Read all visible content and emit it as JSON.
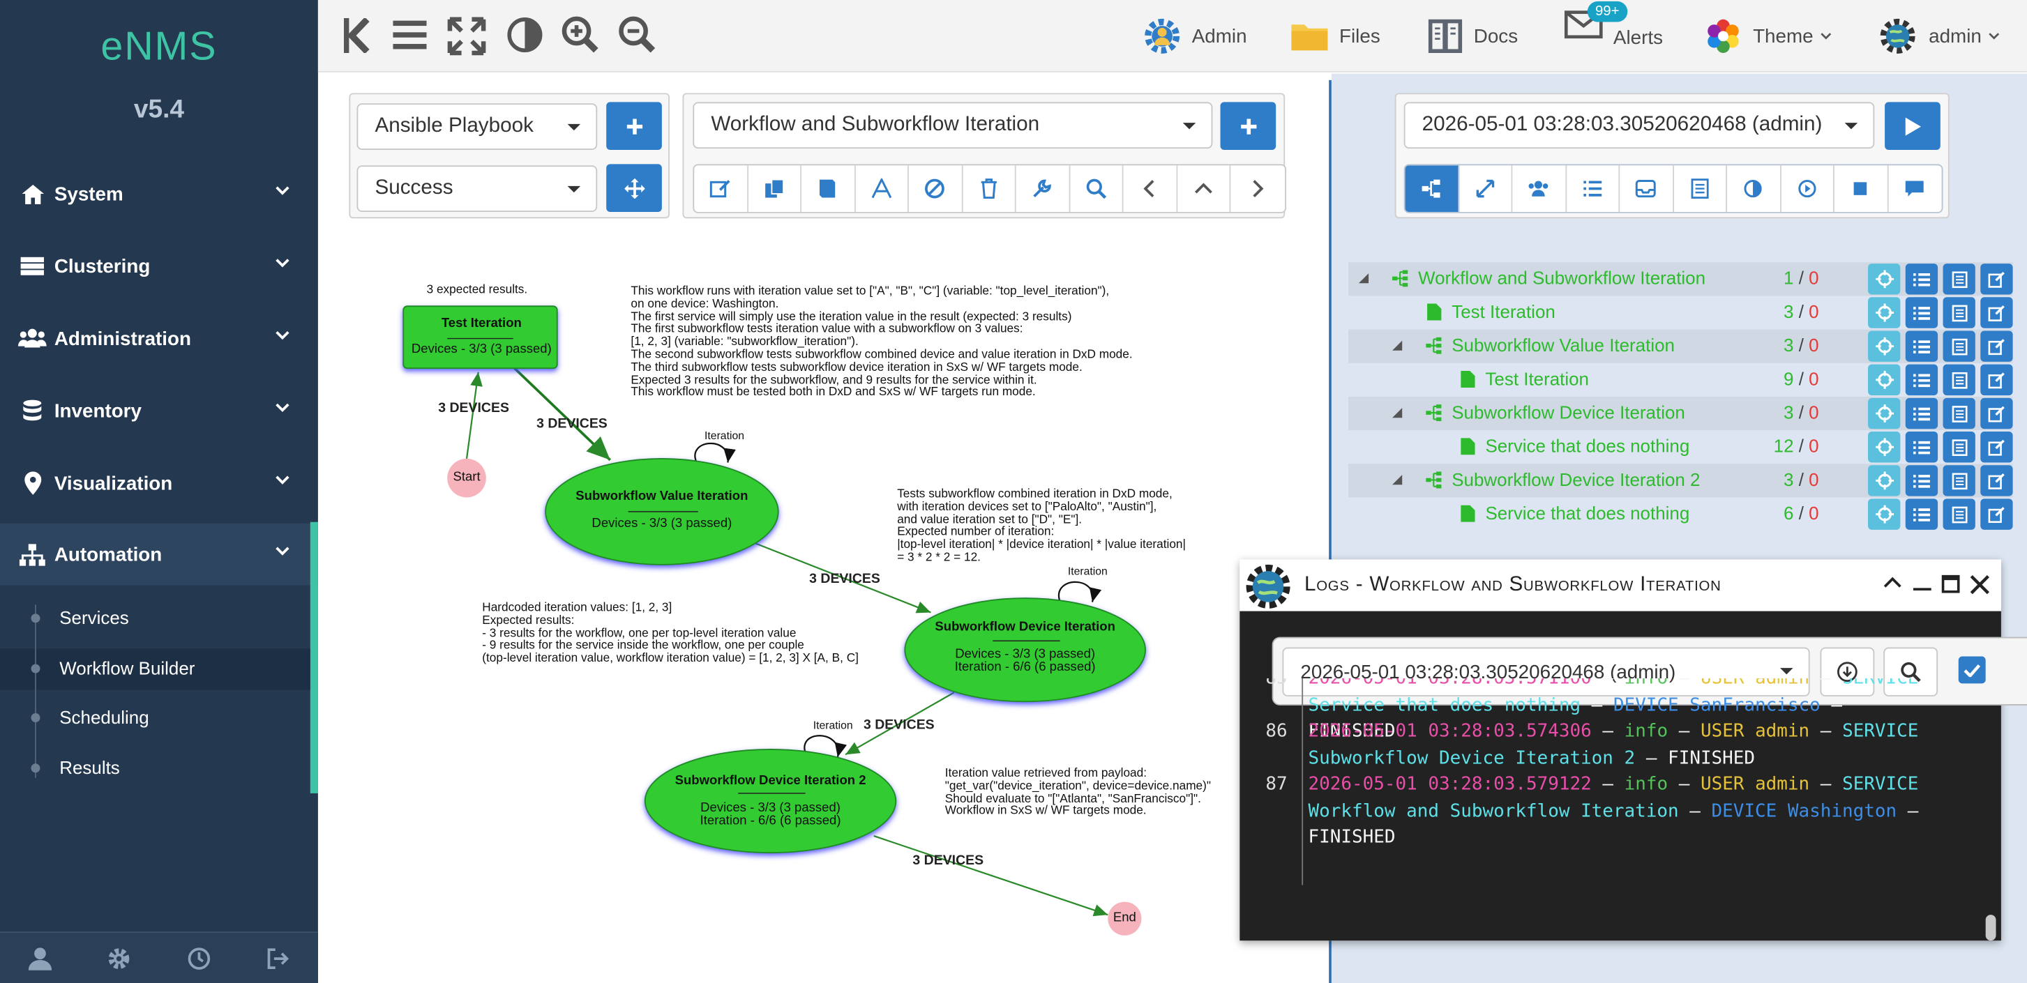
{
  "sidebar": {
    "logo": "eNMS",
    "version": "v5.4",
    "menu": [
      {
        "label": "System",
        "icon": "home-icon"
      },
      {
        "label": "Clustering",
        "icon": "server-icon"
      },
      {
        "label": "Administration",
        "icon": "users-icon"
      },
      {
        "label": "Inventory",
        "icon": "database-icon"
      },
      {
        "label": "Visualization",
        "icon": "map-marker-icon"
      },
      {
        "label": "Automation",
        "icon": "sitemap-icon"
      }
    ],
    "automation_submenu": [
      "Services",
      "Workflow Builder",
      "Scheduling",
      "Results"
    ],
    "active_submenu": "Workflow Builder",
    "footer_icons": [
      "user-icon",
      "gear-icon",
      "history-icon",
      "logout-icon"
    ]
  },
  "topbar": {
    "admin_label": "Admin",
    "files_label": "Files",
    "docs_label": "Docs",
    "alerts_label": "Alerts",
    "alerts_badge": "99+",
    "theme_label": "Theme",
    "user_label": "admin"
  },
  "builder": {
    "service_type": "Ansible Playbook",
    "edge_type": "Success",
    "workflow": "Workflow and Subworkflow Iteration",
    "runtime": "2026-05-01 03:28:03.30520620468 (admin)"
  },
  "diagram": {
    "nodes": {
      "test_iteration": {
        "title": "Test Iteration",
        "line1": "Devices - 3/3 (3 passed)"
      },
      "subwf_value": {
        "title": "Subworkflow Value Iteration",
        "line1": "Devices - 3/3 (3 passed)"
      },
      "subwf_device": {
        "title": "Subworkflow Device Iteration",
        "line1": "Devices - 3/3 (3 passed)",
        "line2": "Iteration - 6/6 (6 passed)"
      },
      "subwf_device2": {
        "title": "Subworkflow Device Iteration 2",
        "line1": "Devices - 3/3 (3 passed)",
        "line2": "Iteration - 6/6 (6 passed)"
      },
      "start": "Start",
      "end": "End"
    },
    "edge_label": "3 DEVICES",
    "loop_label": "Iteration",
    "expected_label": "3 expected results.",
    "note1": "This workflow runs with iteration value set to [\"A\", \"B\", \"C\"] (variable: \"top_level_iteration\"),\non one device: Washington.\nThe first service will simply use the iteration value in the result (expected: 3 results)\nThe first subworkflow tests iteration value with a subworkflow on 3 values:\n[1, 2, 3] (variable: \"subworkflow_iteration\").\nThe second subworkflow tests subworkflow combined device and value iteration in DxD mode.\nThe third subworkflow tests subworkflow device iteration in SxS w/ WF targets mode.\nExpected 3 results for the subworkflow, and 9 results for the service within it.\nThis workflow must be tested both in DxD and SxS w/ WF targets run mode.",
    "note2": "Tests subworkflow combined iteration in DxD mode,\nwith iteration devices set to [\"PaloAlto\", \"Austin\"],\nand value iteration set to [\"D\", \"E\"].\nExpected number of iteration:\n|top-level iteration| * |device iteration| * |value iteration|\n= 3 * 2 * 2 = 12.",
    "note3": "Hardcoded iteration values: [1, 2, 3]\nExpected results:\n- 3 results for the workflow, one per top-level iteration value\n- 9 results for the service inside the workflow, one per couple\n(top-level iteration value, workflow iteration value) = [1, 2, 3] X [A, B, C]",
    "note4": "Iteration value retrieved from payload:\n\"get_var(\"device_iteration\", device=device.name)\"\nShould evaluate to \"[\"Atlanta\", \"SanFrancisco\"]\".\nWorkflow in SxS w/ WF targets mode."
  },
  "tree": [
    {
      "label": "Workflow and Subworkflow Iteration",
      "success": "1",
      "failure": "0"
    },
    {
      "label": "Test Iteration",
      "success": "3",
      "failure": "0"
    },
    {
      "label": "Subworkflow Value Iteration",
      "success": "3",
      "failure": "0"
    },
    {
      "label": "Test Iteration",
      "success": "9",
      "failure": "0"
    },
    {
      "label": "Subworkflow Device Iteration",
      "success": "3",
      "failure": "0"
    },
    {
      "label": "Service that does nothing",
      "success": "12",
      "failure": "0"
    },
    {
      "label": "Subworkflow Device Iteration 2",
      "success": "3",
      "failure": "0"
    },
    {
      "label": "Service that does nothing",
      "success": "6",
      "failure": "0"
    }
  ],
  "count_separator": "/",
  "logs": {
    "title": "Logs - Workflow and Subworkflow Iteration",
    "runtime": "2026-05-01 03:28:03.30520620468 (admin)",
    "lines": [
      {
        "n": "85",
        "ts": "2026-05-01 03:28:03.571100",
        "level": "info",
        "user": "USER admin",
        "svc": "SERVICE",
        "name": "Service that does nothing",
        "dev": "DEVICE SanFrancisco",
        "status": "FINISHED"
      },
      {
        "n": "86",
        "ts": "2026-05-01 03:28:03.574306",
        "level": "info",
        "user": "USER admin",
        "svc": "SERVICE",
        "name": "Subworkflow Device Iteration 2",
        "status": "FINISHED"
      },
      {
        "n": "87",
        "ts": "2026-05-01 03:28:03.579122",
        "level": "info",
        "user": "USER admin",
        "svc": "SERVICE",
        "name": "Workflow and Subworkflow Iteration",
        "dev": "DEVICE Washington",
        "status": "FINISHED"
      }
    ],
    "sep": " – "
  }
}
